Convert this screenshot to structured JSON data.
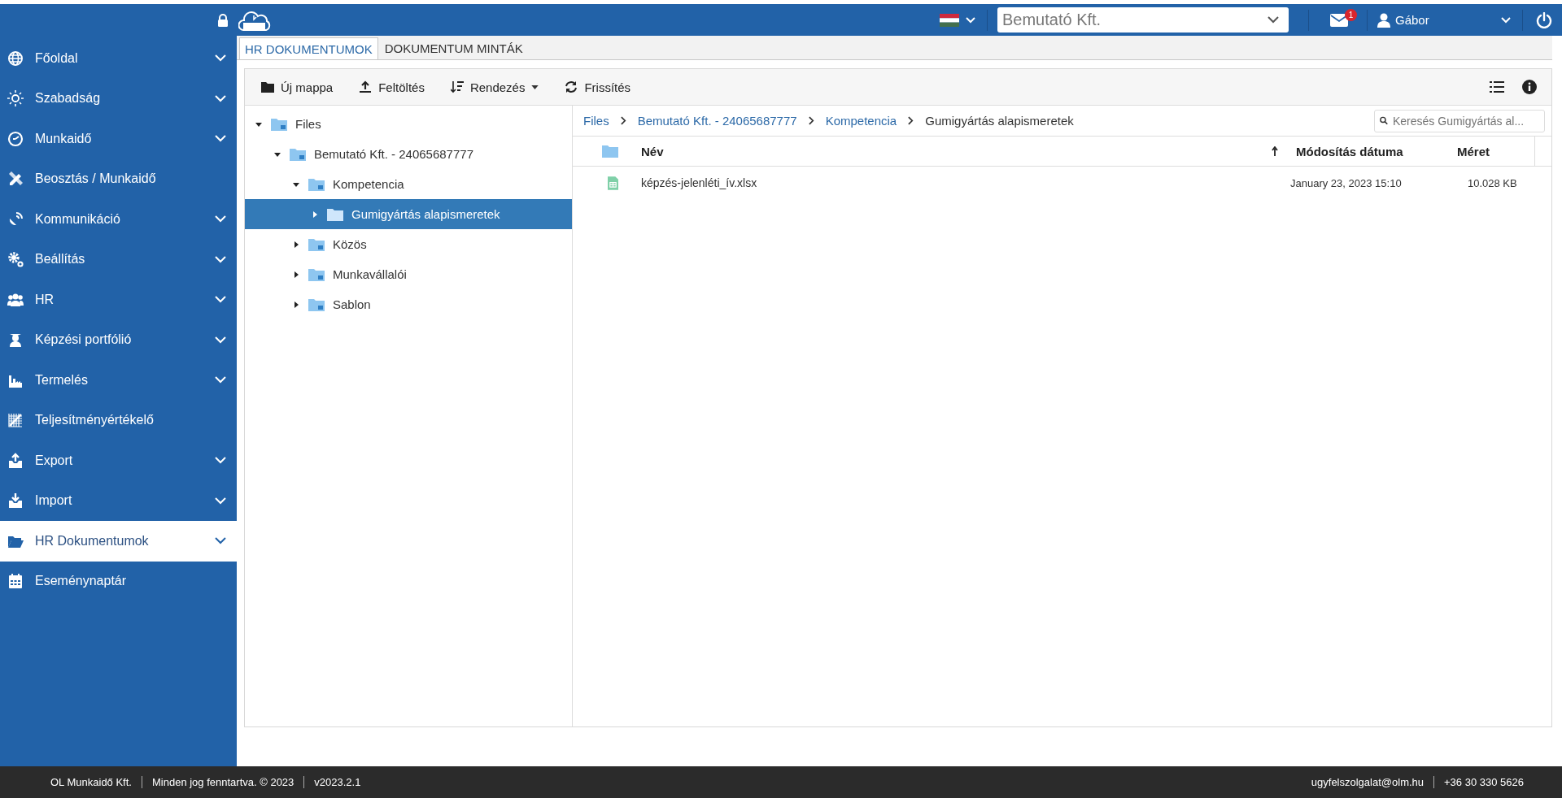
{
  "header": {
    "notifications": "1",
    "company": "Bemutató Kft.",
    "user": "Gábor"
  },
  "sidebar": {
    "items": [
      {
        "label": "Főoldal",
        "expandable": true,
        "selected": false
      },
      {
        "label": "Szabadság",
        "expandable": true,
        "selected": false
      },
      {
        "label": "Munkaidő",
        "expandable": true,
        "selected": false
      },
      {
        "label": "Beosztás / Munkaidő",
        "expandable": false,
        "selected": false
      },
      {
        "label": "Kommunikáció",
        "expandable": true,
        "selected": false
      },
      {
        "label": "Beállítás",
        "expandable": true,
        "selected": false
      },
      {
        "label": "HR",
        "expandable": true,
        "selected": false
      },
      {
        "label": "Képzési portfólió",
        "expandable": true,
        "selected": false
      },
      {
        "label": "Termelés",
        "expandable": true,
        "selected": false
      },
      {
        "label": "Teljesítményértékelő",
        "expandable": false,
        "selected": false
      },
      {
        "label": "Export",
        "expandable": true,
        "selected": false
      },
      {
        "label": "Import",
        "expandable": true,
        "selected": false
      },
      {
        "label": "HR Dokumentumok",
        "expandable": true,
        "selected": true
      },
      {
        "label": "Eseménynaptár",
        "expandable": false,
        "selected": false
      }
    ]
  },
  "tabs": [
    {
      "label": "HR DOKUMENTUMOK",
      "selected": true
    },
    {
      "label": "DOKUMENTUM MINTÁK",
      "selected": false
    }
  ],
  "toolbar": [
    {
      "label": "Új mappa",
      "kind": "folder"
    },
    {
      "label": "Feltöltés",
      "kind": "upload"
    },
    {
      "label": "Rendezés",
      "kind": "sort"
    },
    {
      "label": "Frissítés",
      "kind": "refresh"
    }
  ],
  "tree": [
    {
      "label": "Files",
      "expanded": true,
      "selected": false,
      "children": [
        {
          "label": "Bemutató Kft. - 24065687777",
          "expanded": true,
          "selected": false,
          "children": [
            {
              "label": "Kompetencia",
              "expanded": true,
              "selected": false,
              "children": [
                {
                  "label": "Gumigyártás alapismeretek",
                  "expanded": false,
                  "selected": true
                }
              ]
            },
            {
              "label": "Közös",
              "expanded": false,
              "selected": false
            },
            {
              "label": "Munkavállalói",
              "expanded": false,
              "selected": false
            },
            {
              "label": "Sablon",
              "expanded": false,
              "selected": false
            }
          ]
        }
      ]
    }
  ],
  "breadcrumb": [
    "Files",
    "Bemutató Kft. - 24065687777",
    "Kompetencia",
    "Gumigyártás alapismeretek"
  ],
  "search": {
    "placeholder": "Keresés Gumigyártás al..."
  },
  "table": {
    "columns": [
      {
        "label": "Név",
        "sorted": true
      },
      {
        "label": "Módosítás dátuma",
        "sorted": false
      },
      {
        "label": "Méret",
        "sorted": false
      }
    ],
    "rows": [
      {
        "name": "képzés-jelenléti_ív.xlsx",
        "modified": "January 23, 2023 15:10",
        "size": "10.028 KB"
      }
    ]
  },
  "footer": {
    "left": [
      "OL Munkaidő Kft.",
      "Minden jog fenntartva. © 2023",
      "v2023.2.1"
    ],
    "right": [
      "ugyfelszolgalat@olm.hu",
      "+36 30 330 5626"
    ]
  }
}
